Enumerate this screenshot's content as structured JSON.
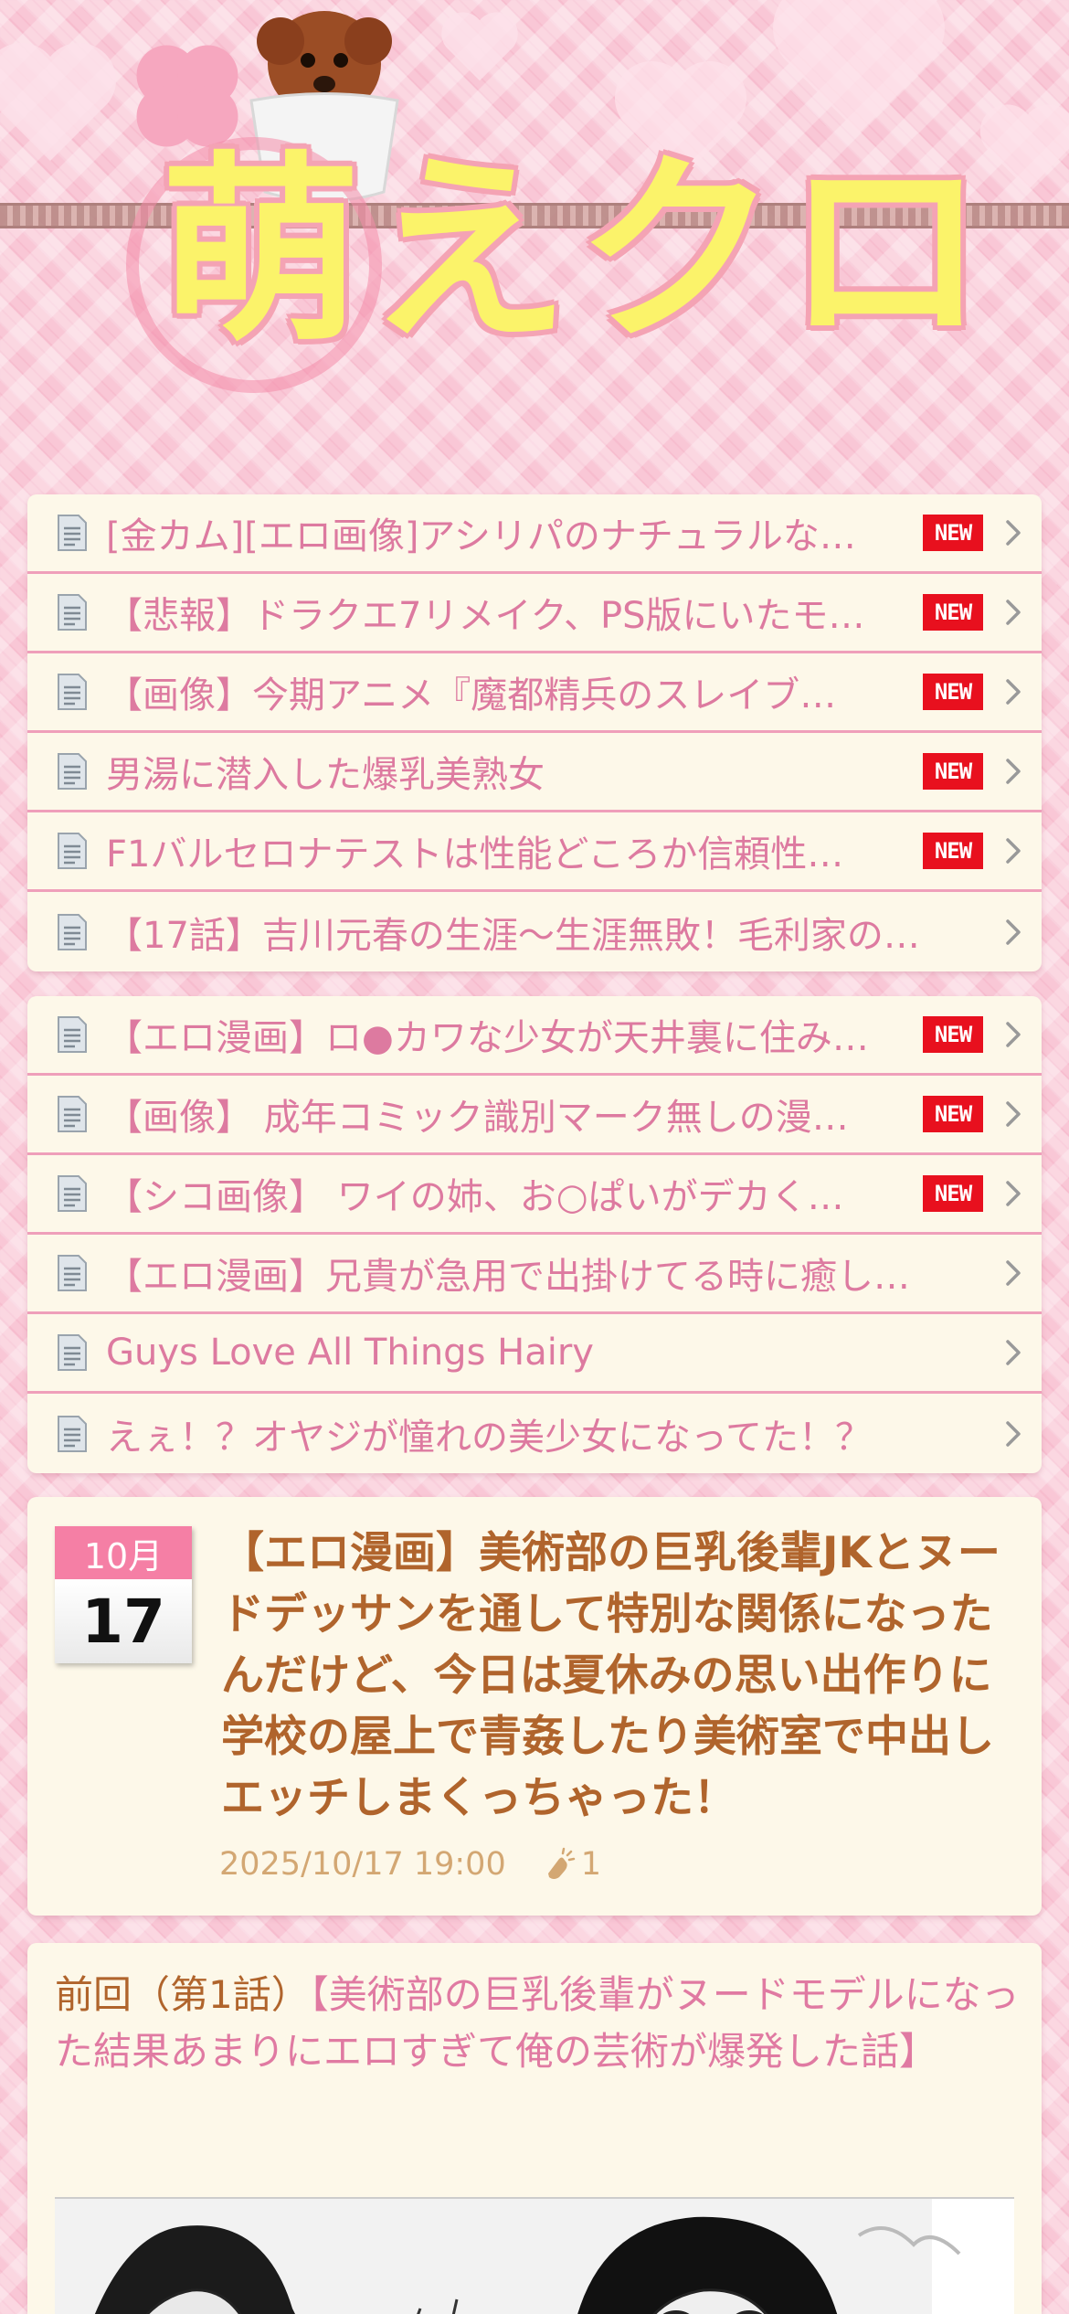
{
  "header": {
    "logo_text": "萌えクロ"
  },
  "list_a": [
    {
      "label": "[金カム][エロ画像]アシリパのナチュラルな…",
      "is_new": true
    },
    {
      "label": "【悲報】ドラクエ7リメイク、PS版にいたモ…",
      "is_new": true
    },
    {
      "label": "【画像】今期アニメ『魔都精兵のスレイブ…",
      "is_new": true
    },
    {
      "label": "男湯に潜入した爆乳美熟女",
      "is_new": true
    },
    {
      "label": "F1バルセロナテストは性能どころか信頼性…",
      "is_new": true
    },
    {
      "label": "【17話】吉川元春の生涯〜生涯無敗！毛利家の…",
      "is_new": false
    }
  ],
  "list_b": [
    {
      "label": "【エロ漫画】ロ●カワな少女が天井裏に住み…",
      "is_new": true
    },
    {
      "label": "【画像】 成年コミック識別マーク無しの漫…",
      "is_new": true
    },
    {
      "label": "【シコ画像】 ワイの姉、お○ぱいがデカく…",
      "is_new": true
    },
    {
      "label": "【エロ漫画】兄貴が急用で出掛けてる時に癒し…",
      "is_new": false
    },
    {
      "label": "Guys Love All Things Hairy",
      "is_new": false
    },
    {
      "label": "えぇ！？オヤジが憧れの美少女になってた！？",
      "is_new": false
    }
  ],
  "badge_text": "NEW",
  "article": {
    "month": "10月",
    "day": "17",
    "title": "【エロ漫画】美術部の巨乳後輩JKとヌードデッサンを通して特別な関係になったんだけど、今日は夏休みの思い出作りに学校の屋上で青姦したり美術室で中出しエッチしまくっちゃった！",
    "datetime": "2025/10/17 19:00",
    "clap_count": "1"
  },
  "body": {
    "prev_prefix": "前回（第1話）",
    "prev_link": "【美術部の巨乳後輩がヌードモデルになった結果あまりにエロすぎて俺の芸術が爆発した話】"
  },
  "colors": {
    "background": "#f9c7d6",
    "card": "#fdf8e9",
    "link_pink": "#dd7aa0",
    "title_brown": "#b0642c",
    "new_red": "#e8101e",
    "logo_yellow": "#fbf36a"
  },
  "icons": [
    "document-icon",
    "chevron-right-icon",
    "clap-icon"
  ]
}
